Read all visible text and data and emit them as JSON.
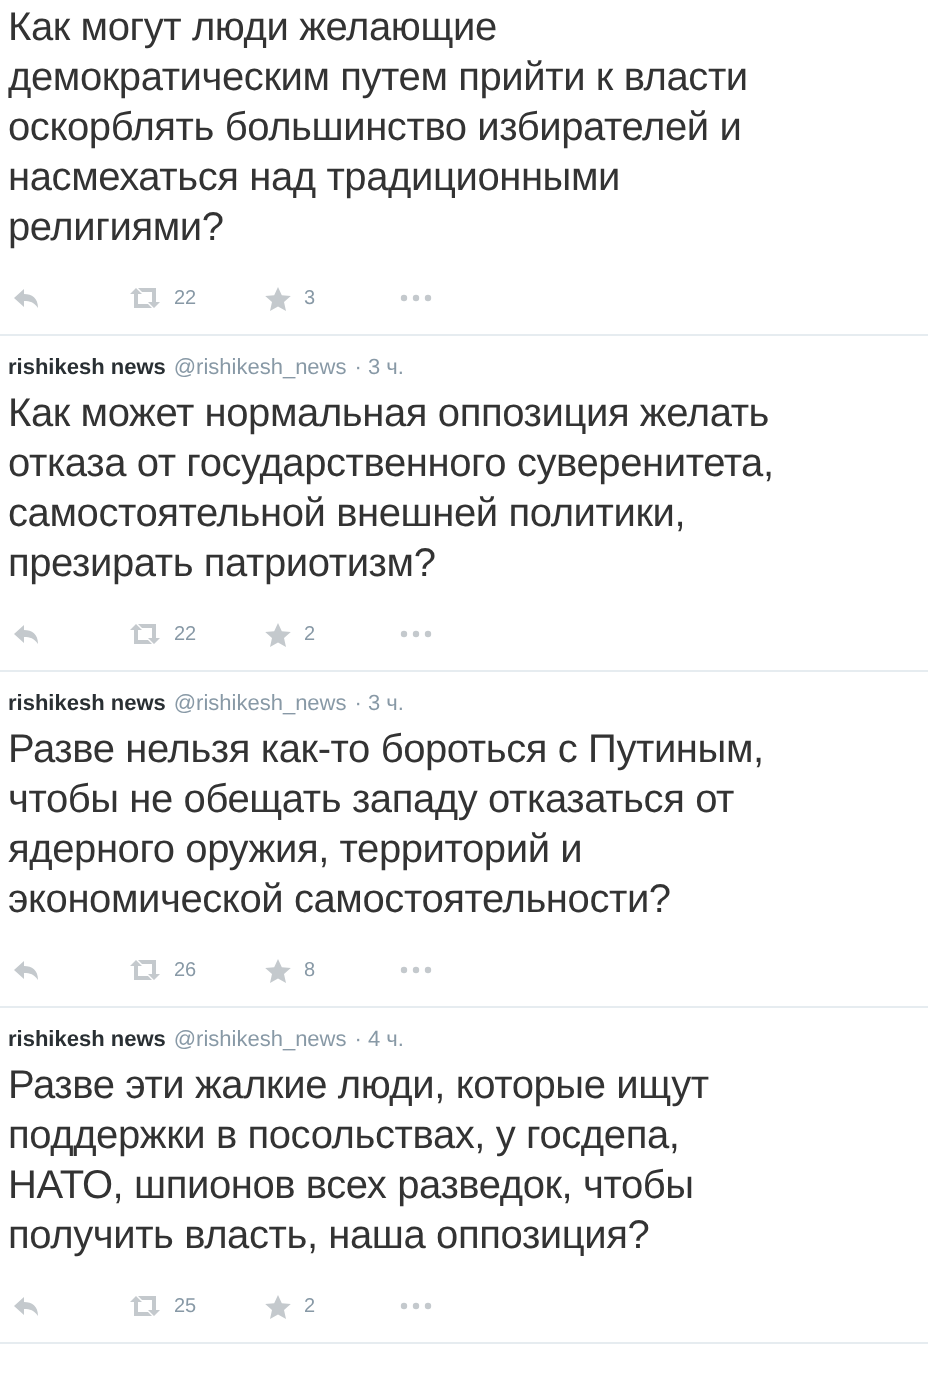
{
  "tweets": [
    {
      "text": "Как могут люди желающие\nдемократическим путем прийти к власти\nоскорблять большинство избирателей и\nнасмехаться над традиционными\nрелигиями?",
      "retweets": "22",
      "favorites": "3"
    },
    {
      "author": "rishikesh news",
      "handle": "@rishikesh_news",
      "time": "· 3 ч.",
      "text": "Как может нормальная оппозиция желать\nотказа от государственного суверенитета,\nсамостоятельной внешней политики,\nпрезирать патриотизм?",
      "retweets": "22",
      "favorites": "2"
    },
    {
      "author": "rishikesh news",
      "handle": "@rishikesh_news",
      "time": "· 3 ч.",
      "text": "Разве нельзя как-то бороться с Путиным,\nчтобы не обещать западу отказаться от\nядерного оружия, территорий и\nэкономической самостоятельности?",
      "retweets": "26",
      "favorites": "8"
    },
    {
      "author": "rishikesh news",
      "handle": "@rishikesh_news",
      "time": "· 4 ч.",
      "text": "Разве эти жалкие люди, которые ищут\nподдержки в посольствах, у госдепа,\nНАТО, шпионов всех разведок, чтобы\nполучить власть, наша оппозиция?",
      "retweets": "25",
      "favorites": "2"
    }
  ]
}
